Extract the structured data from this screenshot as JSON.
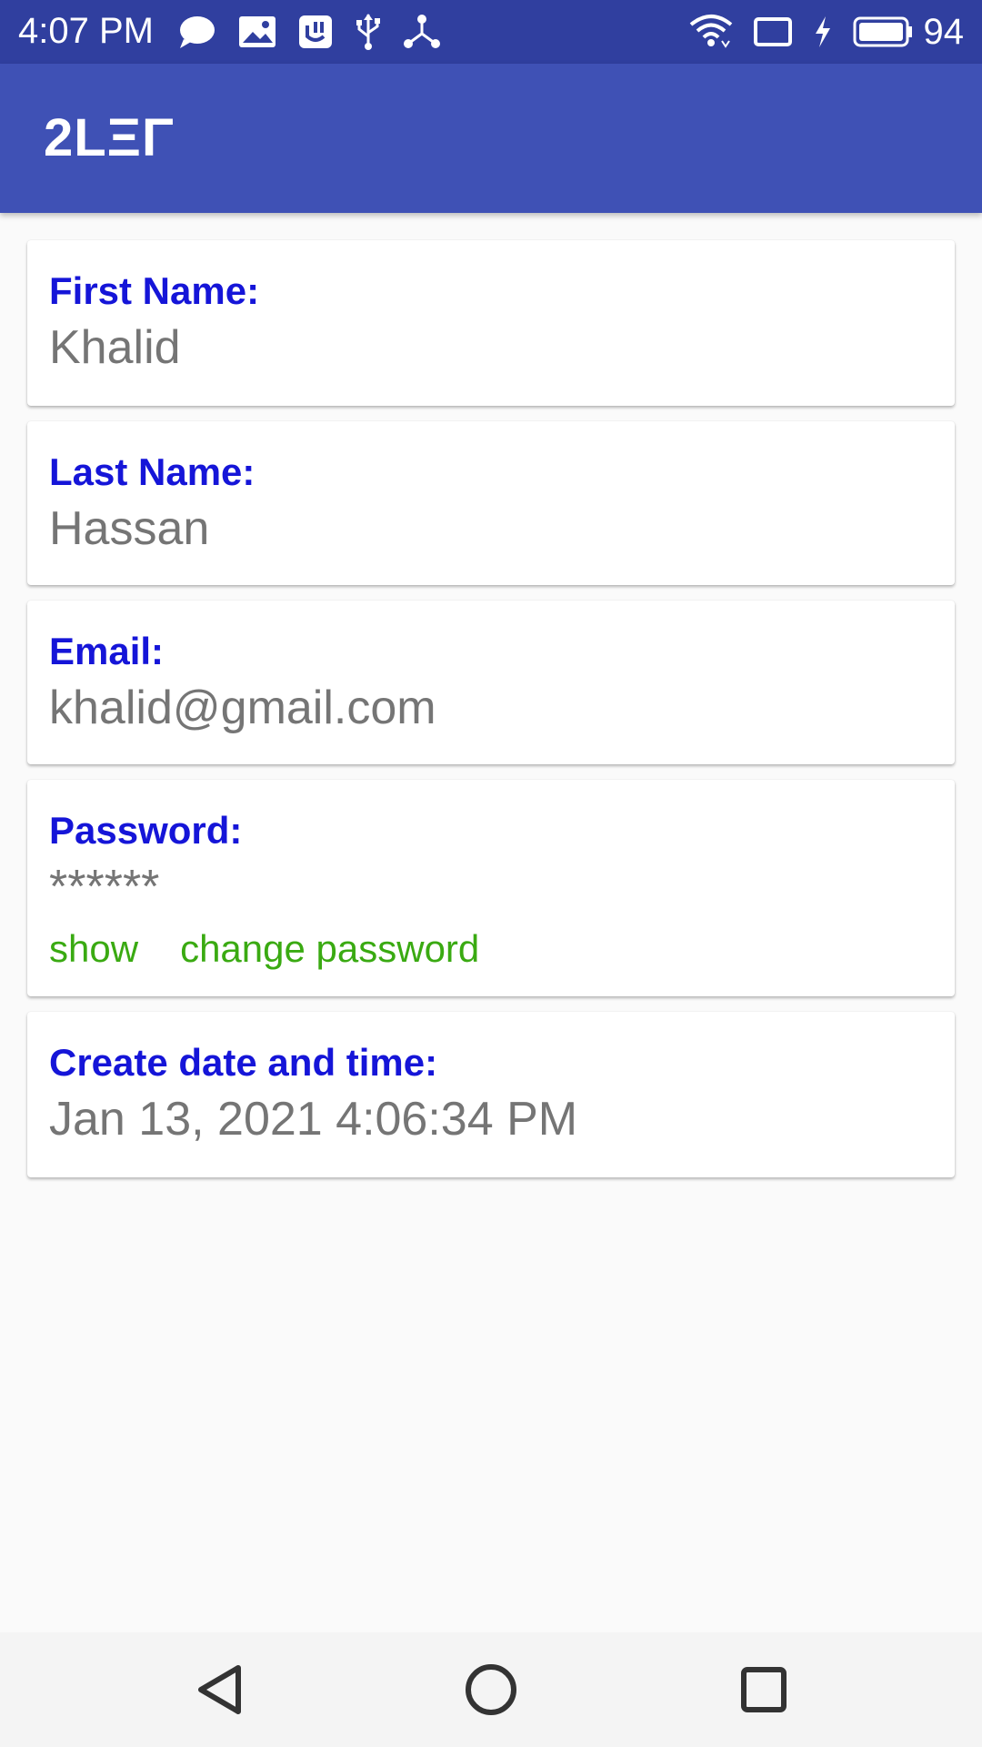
{
  "status_bar": {
    "time": "4:07 PM",
    "battery_percent": "94",
    "icons_left": [
      "chat-icon",
      "gallery-icon",
      "keyboard-app-icon",
      "usb-icon",
      "share-icon"
    ],
    "icons_right": [
      "wifi-icon",
      "cast-icon",
      "charging-icon",
      "battery-icon"
    ],
    "bg_color": "#303f9f"
  },
  "app_bar": {
    "title": "2LΞΓ",
    "bg_color": "#3f51b5"
  },
  "profile": {
    "first_name": {
      "label": "First Name:",
      "value": "Khalid"
    },
    "last_name": {
      "label": "Last Name:",
      "value": "Hassan"
    },
    "email": {
      "label": "Email:",
      "value": "khalid@gmail.com"
    },
    "password": {
      "label": "Password:",
      "value": "******",
      "show_label": "show",
      "change_label": "change password"
    },
    "created": {
      "label": "Create date and time:",
      "value": "Jan 13, 2021 4:06:34 PM"
    }
  },
  "colors": {
    "label": "#1515d8",
    "value": "#757575",
    "link": "#3aaa12"
  },
  "nav_bar": {
    "buttons": [
      "back-icon",
      "home-icon",
      "recents-icon"
    ]
  }
}
